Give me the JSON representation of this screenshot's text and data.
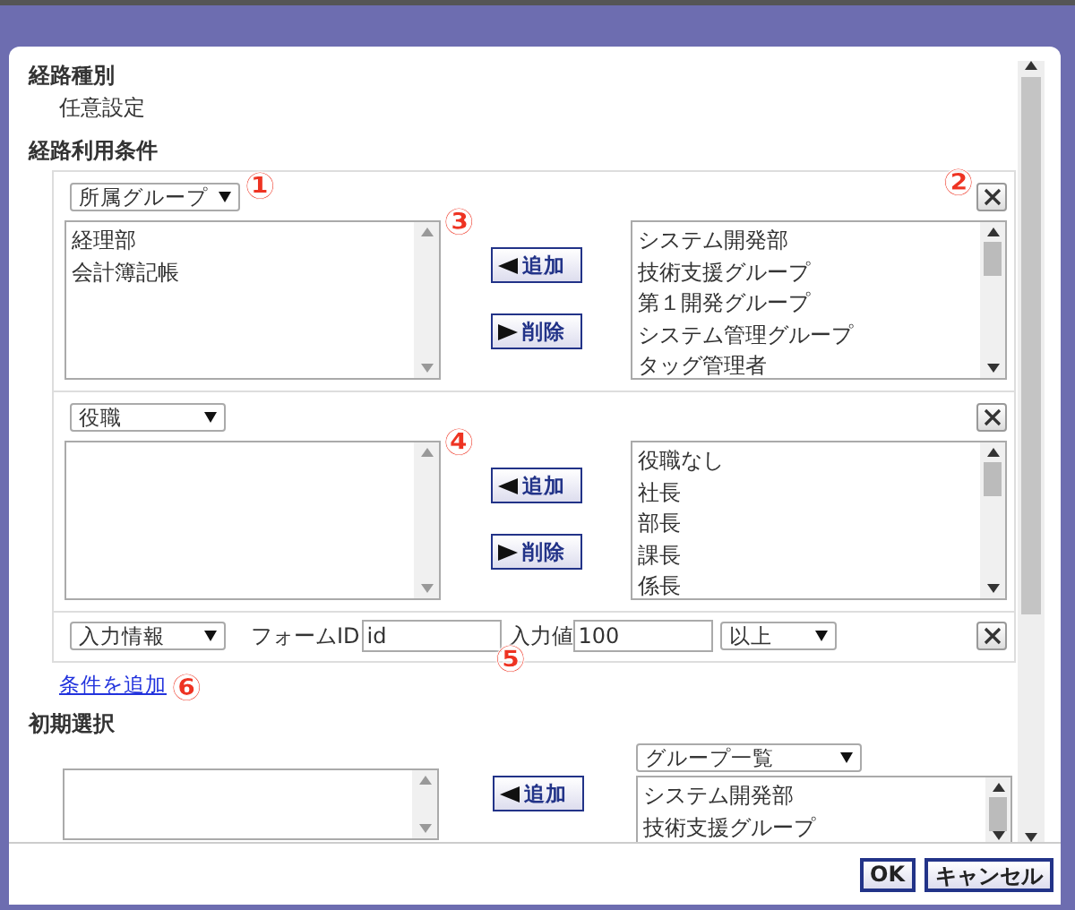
{
  "route_type": {
    "label": "経路種別",
    "value": "任意設定"
  },
  "conditions_section": {
    "label": "経路利用条件",
    "conditions": [
      {
        "kind": "list",
        "type_select": "所属グループ",
        "type_callout": "①",
        "remove_callout": "②",
        "selected_items": [
          "経理部",
          "会計簿記帳"
        ],
        "selected_callout": "③",
        "available_items": [
          "システム開発部",
          "技術支援グループ",
          "第１開発グループ",
          "システム管理グループ",
          "タッグ管理者"
        ],
        "add_button": "追加",
        "delete_button": "削除"
      },
      {
        "kind": "list",
        "type_select": "役職",
        "selected_callout": "④",
        "available_items": [
          "役職なし",
          "社長",
          "部長",
          "課長",
          "係長"
        ],
        "add_button": "追加",
        "delete_button": "削除"
      },
      {
        "kind": "input",
        "type_select": "入力情報",
        "form_id_label": "フォームID",
        "form_id_value": "id",
        "input_callout": "⑤",
        "value_label": "入力値",
        "value": "100",
        "operator": "以上"
      }
    ],
    "add_link": "条件を追加",
    "add_link_callout": "⑥"
  },
  "initial_selection": {
    "label": "初期選択",
    "list_select": "グループ一覧",
    "available_items": [
      "システム開発部",
      "技術支援グループ"
    ],
    "add_button": "追加"
  },
  "buttons": [
    {
      "label": "OK"
    },
    {
      "label": "キャンセル"
    }
  ]
}
